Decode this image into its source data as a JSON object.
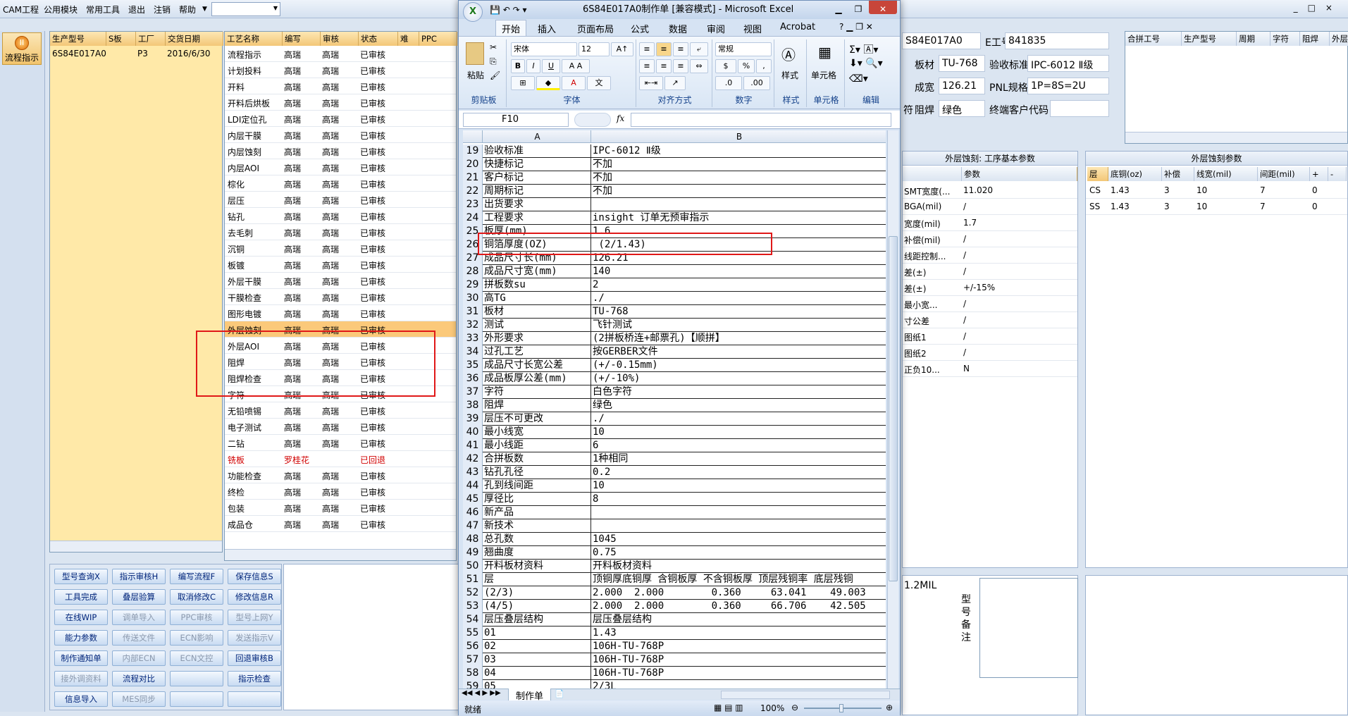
{
  "host": {
    "menu": [
      "CAM工程",
      "公用模块",
      "常用工具",
      "退出",
      "注销",
      "帮助"
    ],
    "flow_btn": "流程指示",
    "list1": {
      "headers": [
        "生产型号",
        "S板",
        "工厂",
        "交货日期"
      ],
      "rows": [
        [
          "6S84E017A0",
          "",
          "P3",
          "2016/6/30"
        ]
      ]
    },
    "list2": {
      "headers": [
        "工艺名称",
        "编写",
        "审核",
        "状态",
        "难",
        "PPC"
      ],
      "rows": [
        [
          "流程指示",
          "高瑞",
          "高瑞",
          "已审核"
        ],
        [
          "计划投料",
          "高瑞",
          "高瑞",
          "已审核"
        ],
        [
          "开料",
          "高瑞",
          "高瑞",
          "已审核"
        ],
        [
          "开料后烘板",
          "高瑞",
          "高瑞",
          "已审核"
        ],
        [
          "LDI定位孔",
          "高瑞",
          "高瑞",
          "已审核"
        ],
        [
          "内层干膜",
          "高瑞",
          "高瑞",
          "已审核"
        ],
        [
          "内层蚀刻",
          "高瑞",
          "高瑞",
          "已审核"
        ],
        [
          "内层AOI",
          "高瑞",
          "高瑞",
          "已审核"
        ],
        [
          "棕化",
          "高瑞",
          "高瑞",
          "已审核"
        ],
        [
          "层压",
          "高瑞",
          "高瑞",
          "已审核"
        ],
        [
          "钻孔",
          "高瑞",
          "高瑞",
          "已审核"
        ],
        [
          "去毛刺",
          "高瑞",
          "高瑞",
          "已审核"
        ],
        [
          "沉铜",
          "高瑞",
          "高瑞",
          "已审核"
        ],
        [
          "板镀",
          "高瑞",
          "高瑞",
          "已审核"
        ],
        [
          "外层干膜",
          "高瑞",
          "高瑞",
          "已审核"
        ],
        [
          "干膜检查",
          "高瑞",
          "高瑞",
          "已审核"
        ],
        [
          "图形电镀",
          "高瑞",
          "高瑞",
          "已审核"
        ],
        [
          "外层蚀刻",
          "高瑞",
          "高瑞",
          "已审核"
        ],
        [
          "外层AOI",
          "高瑞",
          "高瑞",
          "已审核"
        ],
        [
          "阻焊",
          "高瑞",
          "高瑞",
          "已审核"
        ],
        [
          "阻焊检查",
          "高瑞",
          "高瑞",
          "已审核"
        ],
        [
          "字符",
          "高瑞",
          "高瑞",
          "已审核"
        ],
        [
          "无铅喷锡",
          "高瑞",
          "高瑞",
          "已审核"
        ],
        [
          "电子测试",
          "高瑞",
          "高瑞",
          "已审核"
        ],
        [
          "二钻",
          "高瑞",
          "高瑞",
          "已审核"
        ],
        [
          "铣板",
          "罗桂花",
          "",
          "已回退"
        ],
        [
          "功能检查",
          "高瑞",
          "高瑞",
          "已审核"
        ],
        [
          "终检",
          "高瑞",
          "高瑞",
          "已审核"
        ],
        [
          "包装",
          "高瑞",
          "高瑞",
          "已审核"
        ],
        [
          "成品仓",
          "高瑞",
          "高瑞",
          "已审核"
        ]
      ]
    },
    "buttons": [
      [
        "型号查询X",
        "指示审核H",
        "编写流程F",
        "保存信息S"
      ],
      [
        "工具完成",
        "叠层验算",
        "取消修改C",
        "修改信息R"
      ],
      [
        "在线WIP",
        "调单导入",
        "PPC审核",
        "型号上网Y"
      ],
      [
        "能力参数",
        "传送文件",
        "ECN影响",
        "发送指示V"
      ],
      [
        "制作通知单",
        "内部ECN",
        "ECN文控",
        "回退审核B"
      ],
      [
        "接外调资料",
        "流程对比",
        "",
        "指示检查"
      ],
      [
        "信息导入",
        "MES同步",
        "",
        ""
      ]
    ]
  },
  "right": {
    "part": "S84E017A0",
    "e_label": "E工号",
    "e_value": "841835",
    "board_label": "板材",
    "board_value": "TU-768",
    "acc_label": "验收标准",
    "acc_value": "IPC-6012 Ⅱ级",
    "thick_label": "成宽",
    "thick_value": "126.21",
    "pnl_label": "PNL规格",
    "pnl_value": "1P=8S=2U",
    "mask_prefix": "符",
    "mask_label": "阻焊",
    "mask_value": "绿色",
    "cust_label": "终端客户代码",
    "combo_headers": [
      "合拼工号",
      "生产型号",
      "周期",
      "字符",
      "阻焊",
      "外层"
    ],
    "p1_title": "外层蚀刻: 工序基本参数",
    "p1_col": "参数",
    "p1_rows": [
      [
        "SMT宽度(...",
        "11.020"
      ],
      [
        "BGA(mil)",
        "/"
      ],
      [
        "宽度(mil)",
        "1.7"
      ],
      [
        "补偿(mil)",
        "/"
      ],
      [
        "线距控制...",
        "/"
      ],
      [
        "差(±)",
        "/"
      ],
      [
        "差(±)",
        "+/-15%"
      ],
      [
        "最小宽...",
        "/"
      ],
      [
        "寸公差",
        "/"
      ],
      [
        "图纸1",
        "/"
      ],
      [
        "图纸2",
        "/"
      ],
      [
        "正负10...",
        "N"
      ]
    ],
    "p2_title": "外层蚀刻参数",
    "p2_headers": [
      "层",
      "底铜(oz)",
      "补偿",
      "线宽(mil)",
      "间距(mil)",
      "+",
      "-"
    ],
    "p2_rows": [
      [
        "CS",
        "1.43",
        "3",
        "10",
        "7",
        "0"
      ],
      [
        "SS",
        "1.43",
        "3",
        "10",
        "7",
        "0"
      ]
    ],
    "note_left": "1.2MIL",
    "note_label": "型号备注"
  },
  "excel": {
    "title": "6S84E017A0制作单 [兼容模式] - Microsoft Excel",
    "tabs": [
      "开始",
      "插入",
      "页面布局",
      "公式",
      "数据",
      "审阅",
      "视图",
      "Acrobat"
    ],
    "font": "宋体",
    "size": "12",
    "numfmt": "常规",
    "groups": [
      "剪贴板",
      "字体",
      "对齐方式",
      "数字",
      "样式",
      "单元格",
      "编辑"
    ],
    "paste": "粘贴",
    "style": "样式",
    "cells": "单元格",
    "namebox": "F10",
    "fx": "fx",
    "cols": [
      "A",
      "B"
    ],
    "rows": [
      [
        "19",
        "验收标准",
        "IPC-6012 Ⅱ级"
      ],
      [
        "20",
        "快捷标记",
        "不加"
      ],
      [
        "21",
        "客户标记",
        "不加"
      ],
      [
        "22",
        "周期标记",
        "不加"
      ],
      [
        "23",
        "出货要求",
        ""
      ],
      [
        "24",
        "工程要求",
        "insight 订单无预审指示"
      ],
      [
        "25",
        "板厚(mm)",
        "1.6"
      ],
      [
        "26",
        "铜箔厚度(OZ)",
        " (2/1.43)"
      ],
      [
        "27",
        "成品尺寸长(mm)",
        "126.21"
      ],
      [
        "28",
        "成品尺寸宽(mm)",
        "140"
      ],
      [
        "29",
        "拼板数su",
        "2"
      ],
      [
        "30",
        "高TG",
        "./"
      ],
      [
        "31",
        "板材",
        "TU-768"
      ],
      [
        "32",
        "测试",
        "飞针测试"
      ],
      [
        "33",
        "外形要求",
        "(2拼板桥连+邮票孔)【顺拼】"
      ],
      [
        "34",
        "过孔工艺",
        "按GERBER文件"
      ],
      [
        "35",
        "成品尺寸长宽公差",
        "(+/-0.15mm)"
      ],
      [
        "36",
        "成品板厚公差(mm)",
        "(+/-10%)"
      ],
      [
        "37",
        "字符",
        "白色字符"
      ],
      [
        "38",
        "阻焊",
        "绿色"
      ],
      [
        "39",
        "层压不可更改",
        "./"
      ],
      [
        "40",
        "最小线宽",
        "10"
      ],
      [
        "41",
        "最小线距",
        "6"
      ],
      [
        "42",
        "合拼板数",
        "1种相同"
      ],
      [
        "43",
        "钻孔孔径",
        "0.2"
      ],
      [
        "44",
        "孔到线间距",
        "10"
      ],
      [
        "45",
        "厚径比",
        "8"
      ],
      [
        "46",
        "新产品",
        ""
      ],
      [
        "47",
        "新技术",
        ""
      ],
      [
        "48",
        "总孔数",
        "1045"
      ],
      [
        "49",
        "翘曲度",
        "0.75"
      ],
      [
        "50",
        "开料板材资料",
        "开料板材资料"
      ],
      [
        "51",
        "层",
        "顶铜厚底铜厚 含铜板厚 不含铜板厚 顶层残铜率 底层残铜"
      ],
      [
        "52",
        "(2/3)",
        "2.000  2.000        0.360     63.041    49.003"
      ],
      [
        "53",
        "(4/5)",
        "2.000  2.000        0.360     66.706    42.505"
      ],
      [
        "54",
        "层压叠层结构",
        "层压叠层结构"
      ],
      [
        "55",
        "01",
        "1.43"
      ],
      [
        "56",
        "02",
        "106H-TU-768P"
      ],
      [
        "57",
        "03",
        "106H-TU-768P"
      ],
      [
        "58",
        "04",
        "106H-TU-768P"
      ],
      [
        "59",
        "05",
        "2/3L"
      ]
    ],
    "sheet_tab": "制作单",
    "status": "就绪",
    "zoom": "100%"
  }
}
